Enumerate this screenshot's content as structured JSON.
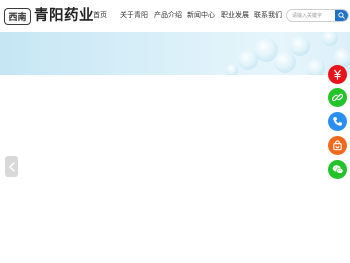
{
  "header": {
    "logo_mark": "西南",
    "brand_name": "青阳药业"
  },
  "nav": {
    "items": [
      {
        "label": "首页"
      },
      {
        "label": "关于青阳"
      },
      {
        "label": "产品介绍"
      },
      {
        "label": "新闻中心"
      },
      {
        "label": "职业发展"
      },
      {
        "label": "联系我们"
      }
    ]
  },
  "search": {
    "placeholder": "请输入关键字"
  },
  "side_buttons": [
    {
      "icon": "yuan-icon",
      "color": "#e8141c"
    },
    {
      "icon": "link-icon",
      "color": "#23c32a"
    },
    {
      "icon": "phone-icon",
      "color": "#2a8ff0"
    },
    {
      "icon": "shop-icon",
      "color": "#f06a1e"
    },
    {
      "icon": "wechat-icon",
      "color": "#23c32a"
    }
  ],
  "colors": {
    "accent": "#1e73c8",
    "banner": "#d4edf7"
  }
}
